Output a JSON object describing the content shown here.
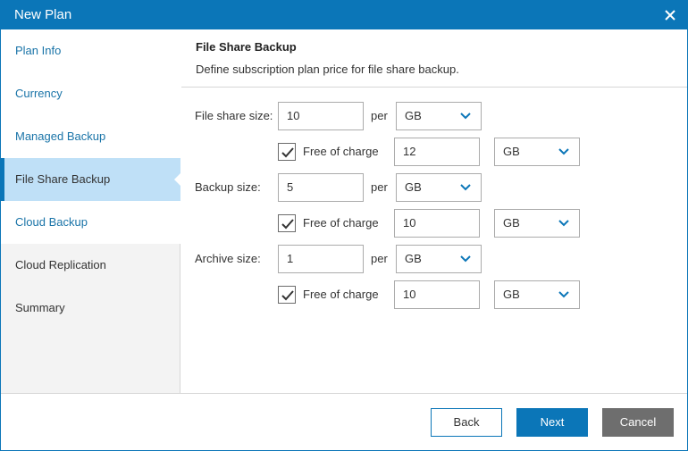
{
  "window": {
    "title": "New Plan"
  },
  "sidebar": {
    "items": [
      {
        "label": "Plan Info",
        "state": "done"
      },
      {
        "label": "Currency",
        "state": "done"
      },
      {
        "label": "Managed Backup",
        "state": "done"
      },
      {
        "label": "File Share Backup",
        "state": "active"
      },
      {
        "label": "Cloud Backup",
        "state": "done"
      },
      {
        "label": "Cloud Replication",
        "state": "pending"
      },
      {
        "label": "Summary",
        "state": "pending"
      }
    ]
  },
  "header": {
    "title": "File Share Backup",
    "subtitle": "Define subscription plan price for file share backup."
  },
  "form": {
    "per_label": "per",
    "free_label": "Free of charge",
    "rows": [
      {
        "label": "File share size:",
        "value": "10",
        "unit": "GB",
        "free_checked": true,
        "free_value": "12",
        "free_unit": "GB"
      },
      {
        "label": "Backup size:",
        "value": "5",
        "unit": "GB",
        "free_checked": true,
        "free_value": "10",
        "free_unit": "GB"
      },
      {
        "label": "Archive size:",
        "value": "1",
        "unit": "GB",
        "free_checked": true,
        "free_value": "10",
        "free_unit": "GB"
      }
    ]
  },
  "footer": {
    "back": "Back",
    "next": "Next",
    "cancel": "Cancel"
  },
  "colors": {
    "accent": "#0b76b8",
    "active_nav": "#bfe0f7",
    "link": "#1a74a8",
    "cancel": "#6e6e6e"
  },
  "icons": {
    "close": "close-icon",
    "chevron": "chevron-down-icon",
    "check": "checkmark-icon"
  }
}
